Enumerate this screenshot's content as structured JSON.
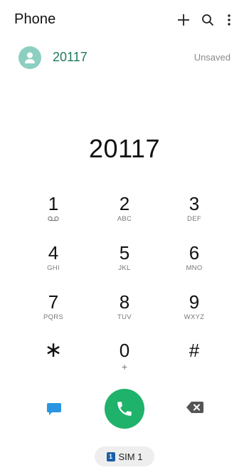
{
  "header": {
    "title": "Phone",
    "actions": [
      "add-icon",
      "search-icon",
      "more-vert-icon"
    ]
  },
  "suggestion": {
    "number": "20117",
    "status": "Unsaved",
    "avatar_color": "#8ccfc0",
    "number_color": "#1f7a5c"
  },
  "dialer": {
    "number": "20117"
  },
  "keypad": {
    "k1": {
      "digit": "1",
      "sub_icon": "voicemail-icon"
    },
    "k2": {
      "digit": "2",
      "letters": "ABC"
    },
    "k3": {
      "digit": "3",
      "letters": "DEF"
    },
    "k4": {
      "digit": "4",
      "letters": "GHI"
    },
    "k5": {
      "digit": "5",
      "letters": "JKL"
    },
    "k6": {
      "digit": "6",
      "letters": "MNO"
    },
    "k7": {
      "digit": "7",
      "letters": "PQRS"
    },
    "k8": {
      "digit": "8",
      "letters": "TUV"
    },
    "k9": {
      "digit": "9",
      "letters": "WXYZ"
    },
    "kstar": {
      "digit": "∗"
    },
    "k0": {
      "digit": "0",
      "letters": "+"
    },
    "khash": {
      "digit": "#"
    }
  },
  "actions": {
    "message_icon": "message-icon",
    "call_icon": "phone-icon",
    "backspace_icon": "backspace-icon",
    "call_color": "#1fb26a",
    "message_color": "#2a95e0"
  },
  "sim": {
    "badge": "1",
    "label": "SIM 1",
    "badge_color": "#1b5fa8"
  }
}
